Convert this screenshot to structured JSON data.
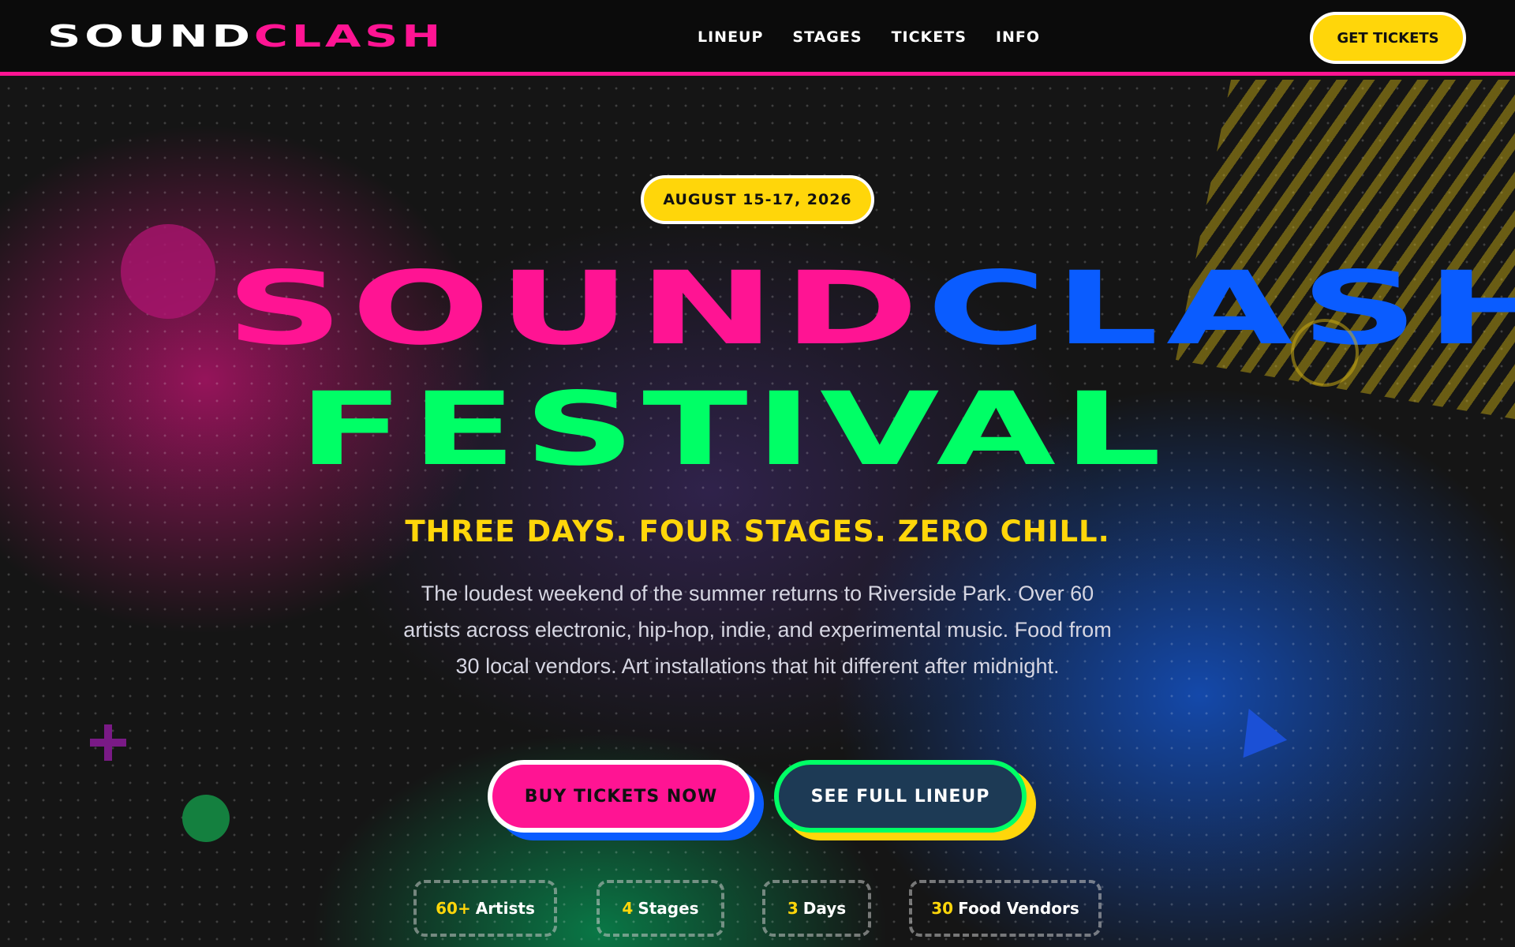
{
  "nav": {
    "logo_part1": "SOUND",
    "logo_part2": "CLASH",
    "links": [
      "LINEUP",
      "STAGES",
      "TICKETS",
      "INFO"
    ],
    "cta_label": "GET TICKETS"
  },
  "hero": {
    "date": "AUGUST 15-17, 2026",
    "title_part1": "SOUND",
    "title_part2": "CLASH",
    "title_line2": "FESTIVAL",
    "tagline": "THREE DAYS. FOUR STAGES. ZERO CHILL.",
    "description": "The loudest weekend of the summer returns to Riverside Park. Over 60 artists across electronic, hip-hop, indie, and experimental music. Food from 30 local vendors. Art installations that hit different after midnight.",
    "primary_button": "BUY TICKETS NOW",
    "secondary_button": "SEE FULL LINEUP",
    "stats": [
      {
        "number": "60+",
        "label": "Artists"
      },
      {
        "number": "4",
        "label": "Stages"
      },
      {
        "number": "3",
        "label": "Days"
      },
      {
        "number": "30",
        "label": "Food Vendors"
      }
    ]
  },
  "colors": {
    "pink": "#ff1493",
    "blue": "#0a5cff",
    "green": "#00ff66",
    "yellow": "#ffd60a",
    "nav_bg": "#0b0b0b"
  }
}
